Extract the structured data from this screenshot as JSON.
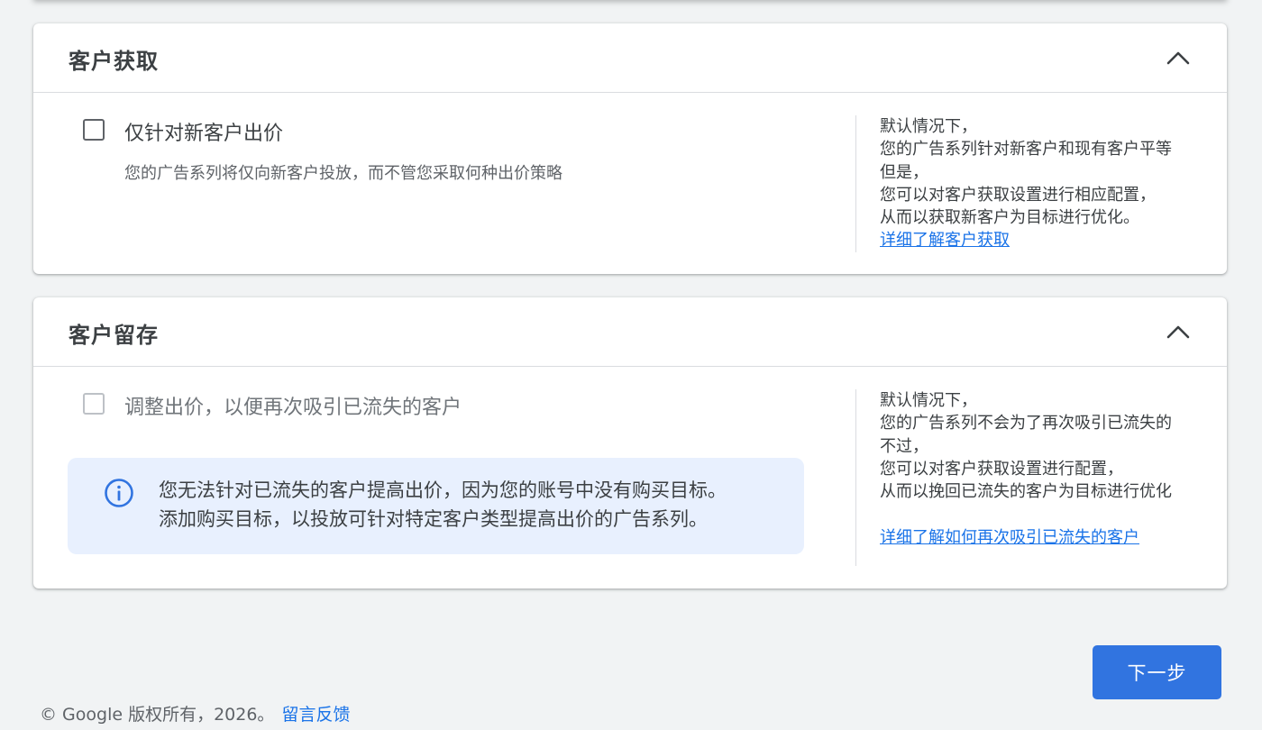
{
  "acquisition": {
    "title": "客户获取",
    "checkbox_label": "仅针对新客户出价",
    "checkbox_checked": false,
    "description": "您的广告系列将仅向新客户投放，而不管您采取何种出价策略",
    "side_lines": [
      "默认情况下，",
      "您的广告系列针对新客户和现有客户平等",
      "但是，",
      "您可以对客户获取设置进行相应配置，",
      "从而以获取新客户为目标进行优化。"
    ],
    "side_link": "详细了解客户获取"
  },
  "retention": {
    "title": "客户留存",
    "checkbox_label": "调整出价，以便再次吸引已流失的客户",
    "checkbox_checked": false,
    "checkbox_disabled": true,
    "info_lines": [
      "您无法针对已流失的客户提高出价，因为您的账号中没有购买目标。",
      "添加购买目标，以投放可针对特定客户类型提高出价的广告系列。"
    ],
    "side_lines": [
      "默认情况下，",
      "您的广告系列不会为了再次吸引已流失的",
      "不过，",
      "您可以对客户获取设置进行配置，",
      "从而以挽回已流失的客户为目标进行优化"
    ],
    "side_link": "详细了解如何再次吸引已流失的客户"
  },
  "next_button": "下一步",
  "footer": {
    "copyright": "© Google 版权所有，2026。",
    "feedback_link": "留言反馈"
  },
  "colors": {
    "accent": "#1a73e8",
    "button": "#3174e0",
    "info_bg": "#e8f0fe",
    "page_bg": "#f1f3f4"
  },
  "icons": {
    "collapse": "chevron-up-icon",
    "info": "info-icon"
  }
}
